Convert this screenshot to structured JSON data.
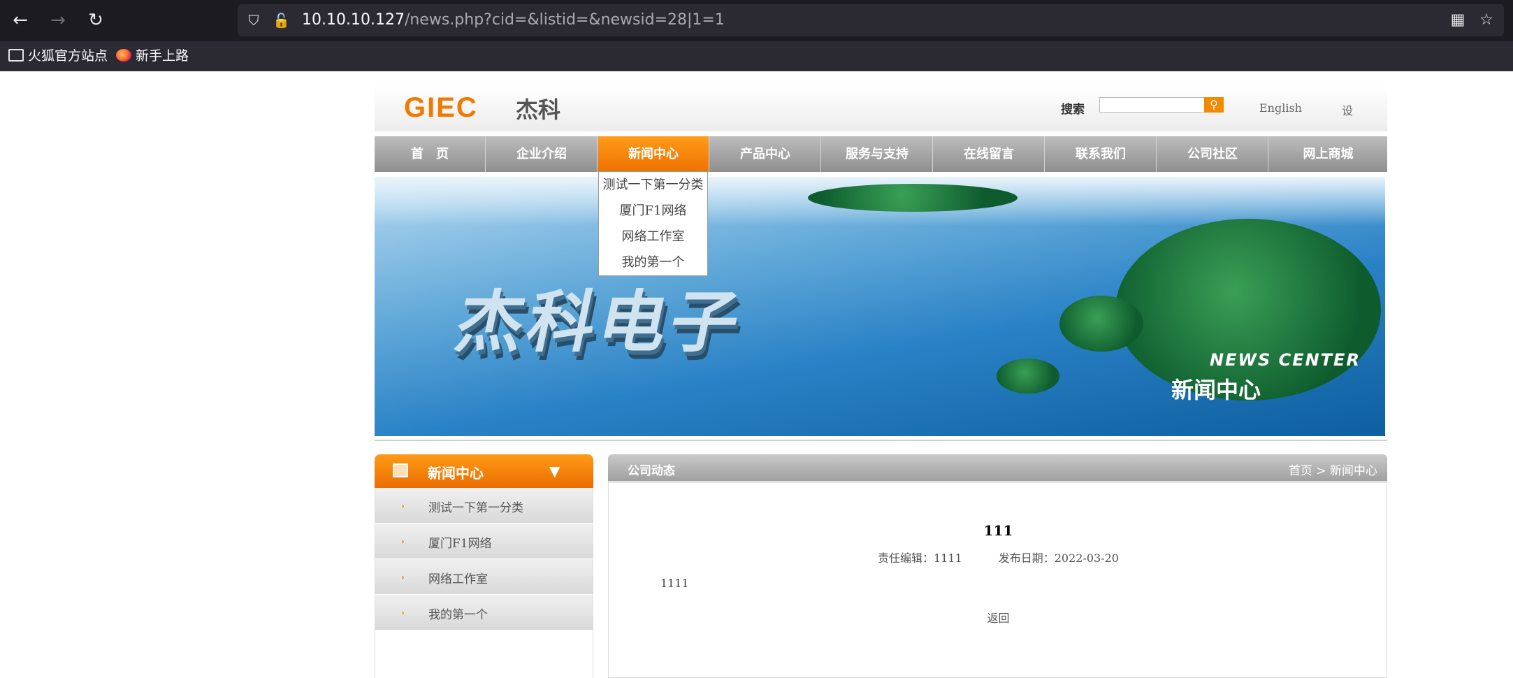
{
  "browser": {
    "url_host": "10.10.10.127",
    "url_path": "/news.php?cid=&listid=&newsid=28|1=1",
    "bookmarks": [
      "火狐官方站点",
      "新手上路"
    ]
  },
  "header": {
    "logo_text": "GIEC",
    "logo_cn": "杰科",
    "search_label": "搜索",
    "search_value": "",
    "lang_link": "English",
    "set_link": "设"
  },
  "nav": {
    "items": [
      "首　页",
      "企业介绍",
      "新闻中心",
      "产品中心",
      "服务与支持",
      "在线留言",
      "联系我们",
      "公司社区",
      "网上商城"
    ],
    "active_index": 2
  },
  "dropdown": {
    "items": [
      "测试一下第一分类",
      "厦门F1网络",
      "网络工作室",
      "我的第一个"
    ]
  },
  "banner": {
    "big_text": "杰科电子",
    "en_text": "NEWS CENTER",
    "cn_text": "新闻中心"
  },
  "sidebar": {
    "title": "新闻中心",
    "items": [
      "测试一下第一分类",
      "厦门F1网络",
      "网络工作室",
      "我的第一个"
    ]
  },
  "main": {
    "title": "公司动态",
    "breadcrumb": "首页 > 新闻中心",
    "article": {
      "title": "111",
      "editor": "责任编辑：1111",
      "date": "发布日期：2022-03-20",
      "content": "1111",
      "back": "返回"
    }
  }
}
